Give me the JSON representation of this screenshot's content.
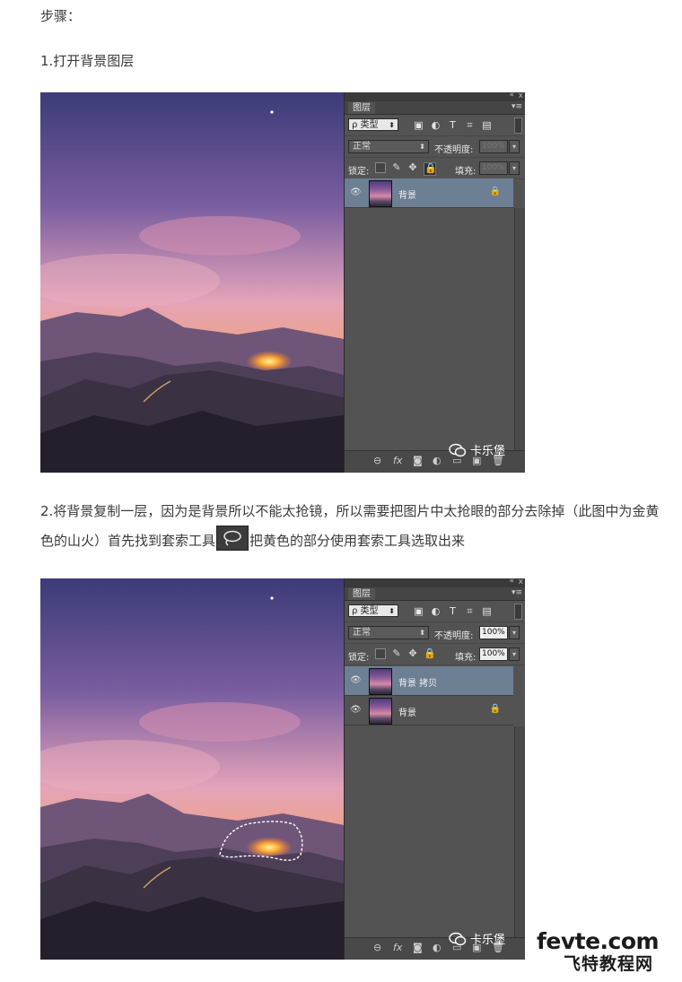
{
  "article": {
    "step_heading": "步骤：",
    "step1": "1.打开背景图层",
    "step2_part1": "2.将背景复制一层，因为是背景所以不能太抢镜，所以需要把图片中太抢眼的部分去除掉（此图中为金黄色的山火）首先找到套索工具",
    "step2_part2": "把黄色的部分使用套索工具选取出来",
    "lasso_icon": "lasso-tool-icon"
  },
  "screenshot1": {
    "panel_title": "图层",
    "collapse_glyph": "«",
    "close_glyph": "x",
    "menu_glyph": "▾≡",
    "filter_label": "ρ 类型",
    "blend_mode": "正常",
    "opacity_label": "不透明度:",
    "opacity_value": "100%",
    "lock_label": "锁定:",
    "fill_label": "填充:",
    "fill_value": "100%",
    "layers": [
      {
        "name": "背景",
        "selected": true,
        "locked": true
      }
    ],
    "watermark": "卡乐堡"
  },
  "screenshot2": {
    "panel_title": "图层",
    "collapse_glyph": "«",
    "close_glyph": "x",
    "menu_glyph": "▾≡",
    "filter_label": "ρ 类型",
    "blend_mode": "正常",
    "opacity_label": "不透明度:",
    "opacity_value": "100%",
    "lock_label": "锁定:",
    "fill_label": "填充:",
    "fill_value": "100%",
    "layers": [
      {
        "name": "背景 拷贝",
        "selected": true,
        "locked": false
      },
      {
        "name": "背景",
        "selected": false,
        "locked": true
      }
    ],
    "watermark": "卡乐堡"
  },
  "site_logo": {
    "line1": "fevte.com",
    "line2": "飞特教程网"
  },
  "colors": {
    "panel_bg": "#535353",
    "selected_layer": "#6d7f93",
    "sky_top": "#3d3a78",
    "sky_glow": "#e6a0b4",
    "fire": "#ffb040"
  }
}
